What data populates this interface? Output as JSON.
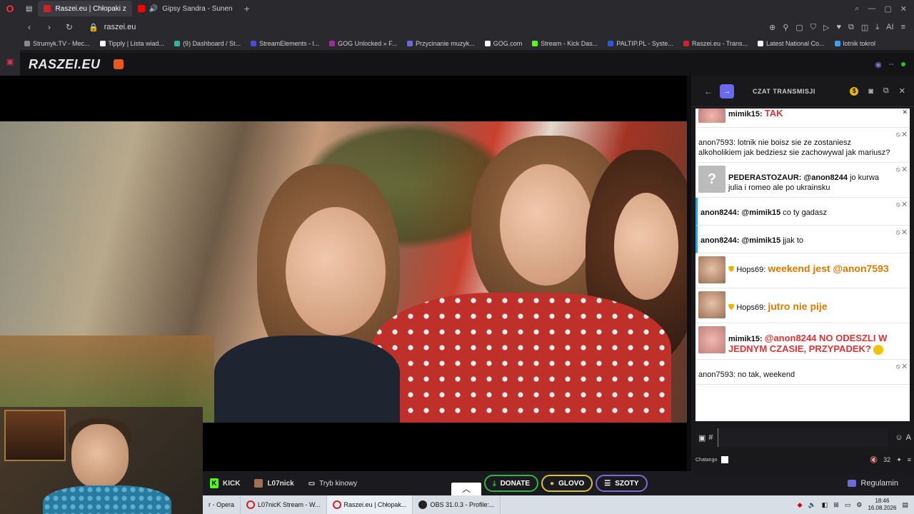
{
  "browser": {
    "tabs": [
      {
        "label": "Raszei.eu | Chłopaki z",
        "color": "#d0202a",
        "active": true
      },
      {
        "label": "Gipsy Sandra - Sunen",
        "color": "#ff0000",
        "active": false
      }
    ],
    "url": "raszei.eu",
    "bookmarks": [
      {
        "label": "Strumyk.TV - Mec...",
        "color": "#888888"
      },
      {
        "label": "Tipply | Lista wiad...",
        "color": "#ffffff"
      },
      {
        "label": "(9) Dashboard / St...",
        "color": "#2fb39a"
      },
      {
        "label": "StreamElements - l...",
        "color": "#4a4ad8"
      },
      {
        "label": "GOG Unlocked » F...",
        "color": "#9a2aa0"
      },
      {
        "label": "Przycinanie muzyk...",
        "color": "#6a6ad8"
      },
      {
        "label": "GOG.com",
        "color": "#ffffff"
      },
      {
        "label": "Stream - Kick Das...",
        "color": "#53fc18"
      },
      {
        "label": "PALTIP.PL - Syste...",
        "color": "#2a5ad8"
      },
      {
        "label": "Raszei.eu - Trans...",
        "color": "#d0202a"
      },
      {
        "label": "Latest National Co...",
        "color": "#ffffff"
      },
      {
        "label": "lotnik tokrol",
        "color": "#3aa0f0"
      }
    ]
  },
  "site": {
    "logo": "RASZEI.EU",
    "status_text": "--"
  },
  "chat": {
    "title": "CZAT TRANSMISJI",
    "messages": [
      {
        "author": "mimik15:",
        "text": "TAK",
        "avatar": "pink",
        "style": "red-partial"
      },
      {
        "author": "",
        "text": "anon7593: lotnik nie boisz sie ze zostaniesz alkoholikiem jak bedziesz sie zachowywal jak mariusz?",
        "avatar": "none",
        "style": "plain"
      },
      {
        "author": "PEDERASTOZAUR: @anon8244",
        "text": "jo kurwa julia i romeo ale po ukrainsku",
        "avatar": "q",
        "style": "plain"
      },
      {
        "author": "anon8244: @mimik15",
        "text": "co ty gadasz",
        "avatar": "none",
        "style": "mention"
      },
      {
        "author": "anon8244: @mimik15",
        "text": "jjak to",
        "avatar": "none",
        "style": "mention"
      },
      {
        "author": "Hops69:",
        "text": "weekend jest @anon7593",
        "avatar": "man",
        "style": "orange"
      },
      {
        "author": "Hops69:",
        "text": "jutro nie pije",
        "avatar": "man",
        "style": "orange"
      },
      {
        "author": "mimik15:",
        "text": "@anon8244 NO ODESZLI W JEDNYM CZASIE, PRZYPADEK?",
        "avatar": "pink",
        "style": "red"
      },
      {
        "author": "",
        "text": "anon7593: no tak, weekend",
        "avatar": "none",
        "style": "plain"
      }
    ],
    "footer_brand": "Chatango",
    "viewer_count": "32"
  },
  "bottom": {
    "kick_label": "KICK",
    "channel_label": "L07nick",
    "cinema_label": "Tryb kinowy",
    "donate_label": "DONATE",
    "glovo_label": "GLOVO",
    "szoty_label": "SZOTY",
    "rules_label": "Regulamin"
  },
  "taskbar": {
    "items": [
      {
        "label": "r - Opera",
        "icon": "none"
      },
      {
        "label": "L07nicK Stream - W...",
        "icon": "opera"
      },
      {
        "label": "Raszei.eu | Chłopak...",
        "icon": "opera",
        "active": true
      },
      {
        "label": "OBS 31.0.3 - Profile:...",
        "icon": "obs"
      }
    ],
    "time": "18:46",
    "date": "16.08.2026"
  }
}
